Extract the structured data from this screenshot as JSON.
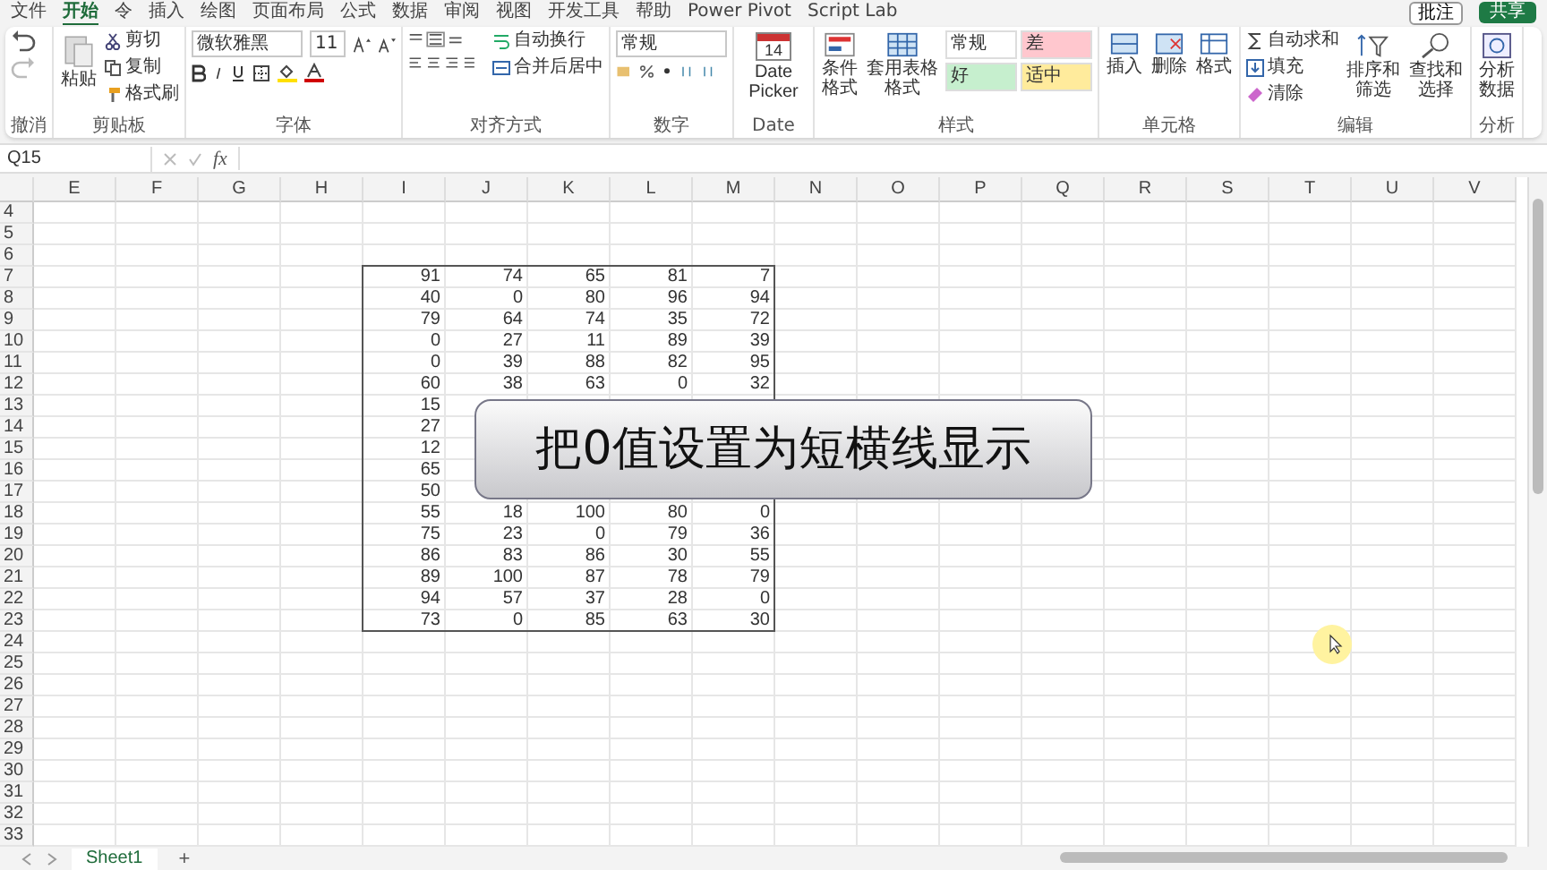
{
  "menu_tabs": [
    {
      "label": "文件",
      "selected": false
    },
    {
      "label": "开始",
      "selected": true
    },
    {
      "label": "令",
      "selected": false
    },
    {
      "label": "插入",
      "selected": false
    },
    {
      "label": "绘图",
      "selected": false
    },
    {
      "label": "页面布局",
      "selected": false
    },
    {
      "label": "公式",
      "selected": false
    },
    {
      "label": "数据",
      "selected": false
    },
    {
      "label": "审阅",
      "selected": false
    },
    {
      "label": "视图",
      "selected": false
    },
    {
      "label": "开发工具",
      "selected": false
    },
    {
      "label": "帮助",
      "selected": false
    },
    {
      "label": "Power Pivot",
      "selected": false
    },
    {
      "label": "Script Lab",
      "selected": false
    }
  ],
  "comment_button": "批注",
  "share_button": "共享",
  "ribbon": {
    "undo": {
      "label": "撤消"
    },
    "clipboard": {
      "label": "剪贴板",
      "paste": "粘贴",
      "cut": "剪切",
      "copy": "复制",
      "format_painter": "格式刷"
    },
    "font": {
      "label": "字体",
      "font_name": "微软雅黑",
      "font_size": "11"
    },
    "alignment": {
      "label": "对齐方式",
      "wrap_text": "自动换行",
      "merge_center": "合并后居中"
    },
    "number": {
      "label": "数字",
      "format": "常规"
    },
    "date": {
      "label": "Date",
      "date_picker": "Date Picker",
      "calendar_day": "14"
    },
    "styles": {
      "label": "样式",
      "conditional_format": "条件格式",
      "format_as_table": "套用表格格式",
      "cell_styles": [
        {
          "label": "常规",
          "color": "#ffffff"
        },
        {
          "label": "差",
          "color": "#ffc7ce"
        },
        {
          "label": "好",
          "color": "#c6efce"
        },
        {
          "label": "适中",
          "color": "#ffeb9c"
        }
      ]
    },
    "cells": {
      "label": "单元格",
      "insert": "插入",
      "delete": "删除",
      "format": "格式"
    },
    "editing": {
      "label": "编辑",
      "autosum": "自动求和",
      "fill": "填充",
      "clear": "清除",
      "sort_filter": "排序和筛选",
      "find_select": "查找和选择"
    },
    "analysis": {
      "label": "分析",
      "analyze_data": "分析数据"
    }
  },
  "formula_bar": {
    "name_box": "Q15",
    "fx_label": "fx"
  },
  "sheet": {
    "columns": [
      "E",
      "F",
      "G",
      "H",
      "I",
      "J",
      "K",
      "L",
      "M",
      "N",
      "O",
      "P",
      "Q",
      "R",
      "S",
      "T",
      "U",
      "V"
    ],
    "rows": [
      {
        "number": "4",
        "values": []
      },
      {
        "number": "5",
        "values": []
      },
      {
        "number": "6",
        "values": []
      },
      {
        "number": "7",
        "values": [
          "91",
          "74",
          "65",
          "81",
          "7"
        ]
      },
      {
        "number": "8",
        "values": [
          "40",
          "0",
          "80",
          "96",
          "94"
        ]
      },
      {
        "number": "9",
        "values": [
          "79",
          "64",
          "74",
          "35",
          "72"
        ]
      },
      {
        "number": "10",
        "values": [
          "0",
          "27",
          "11",
          "89",
          "39"
        ]
      },
      {
        "number": "11",
        "values": [
          "0",
          "39",
          "88",
          "82",
          "95"
        ]
      },
      {
        "number": "12",
        "values": [
          "60",
          "38",
          "63",
          "0",
          "32"
        ]
      },
      {
        "number": "13",
        "values": [
          "15"
        ]
      },
      {
        "number": "14",
        "values": [
          "27"
        ]
      },
      {
        "number": "15",
        "values": [
          "12"
        ]
      },
      {
        "number": "16",
        "values": [
          "65"
        ]
      },
      {
        "number": "17",
        "values": [
          "50"
        ]
      },
      {
        "number": "18",
        "values": [
          "55",
          "18",
          "100",
          "80",
          "0"
        ]
      },
      {
        "number": "19",
        "values": [
          "75",
          "23",
          "0",
          "79",
          "36"
        ]
      },
      {
        "number": "20",
        "values": [
          "86",
          "83",
          "86",
          "30",
          "55"
        ]
      },
      {
        "number": "21",
        "values": [
          "89",
          "100",
          "87",
          "78",
          "79"
        ]
      },
      {
        "number": "22",
        "values": [
          "94",
          "57",
          "37",
          "28",
          "0"
        ]
      },
      {
        "number": "23",
        "values": [
          "73",
          "0",
          "85",
          "63",
          "30"
        ]
      },
      {
        "number": "24",
        "values": []
      },
      {
        "number": "25",
        "values": []
      },
      {
        "number": "26",
        "values": []
      },
      {
        "number": "27",
        "values": []
      },
      {
        "number": "28",
        "values": []
      },
      {
        "number": "29",
        "values": []
      },
      {
        "number": "30",
        "values": []
      },
      {
        "number": "31",
        "values": []
      },
      {
        "number": "32",
        "values": []
      },
      {
        "number": "33",
        "values": []
      }
    ]
  },
  "callout": "把0值设置为短横线显示",
  "sheet_tabs": [
    {
      "label": "Sheet1",
      "selected": true
    }
  ],
  "add_sheet": "+"
}
